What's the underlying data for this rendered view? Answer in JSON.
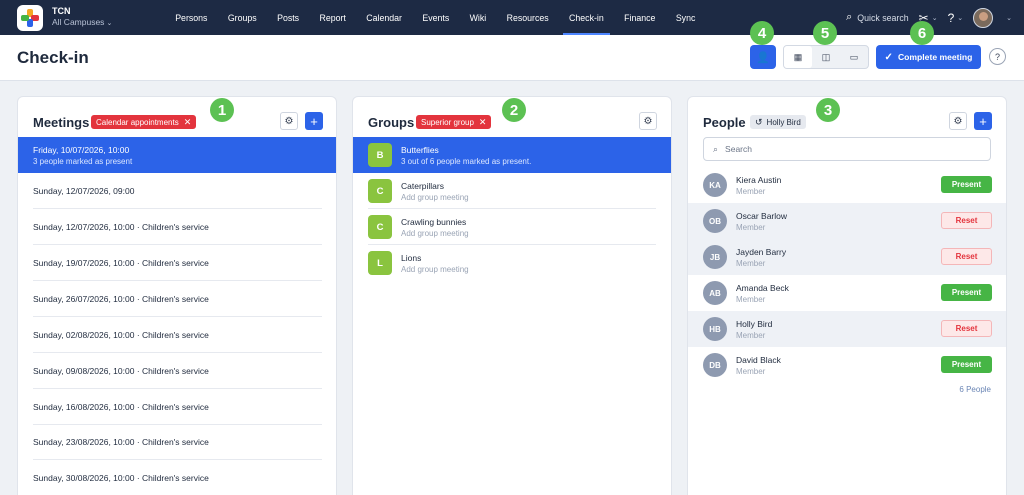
{
  "brand": {
    "name": "TCN",
    "campus": "All Campuses"
  },
  "nav": {
    "items": [
      "Persons",
      "Groups",
      "Posts",
      "Report",
      "Calendar",
      "Events",
      "Wiki",
      "Resources",
      "Check-in",
      "Finance",
      "Sync"
    ],
    "active": "Check-in",
    "quick_search": "Quick search",
    "help": "?"
  },
  "page": {
    "title": "Check-in",
    "complete_label": "Complete meeting",
    "help": "?"
  },
  "callouts": [
    "1",
    "2",
    "3",
    "4",
    "5",
    "6"
  ],
  "meetings": {
    "title": "Meetings",
    "filter_chip": "Calendar appointments",
    "items": [
      {
        "title": "Friday, 10/07/2026, 10:00",
        "sub": "3 people marked as present",
        "selected": true
      },
      {
        "title": "Sunday, 12/07/2026, 09:00"
      },
      {
        "title": "Sunday, 12/07/2026, 10:00 · Children's service"
      },
      {
        "title": "Sunday, 19/07/2026, 10:00 · Children's service"
      },
      {
        "title": "Sunday, 26/07/2026, 10:00 · Children's service"
      },
      {
        "title": "Sunday, 02/08/2026, 10:00 · Children's service"
      },
      {
        "title": "Sunday, 09/08/2026, 10:00 · Children's service"
      },
      {
        "title": "Sunday, 16/08/2026, 10:00 · Children's service"
      },
      {
        "title": "Sunday, 23/08/2026, 10:00 · Children's service"
      },
      {
        "title": "Sunday, 30/08/2026, 10:00 · Children's service"
      }
    ]
  },
  "groups": {
    "title": "Groups",
    "filter_chip": "Superior group",
    "items": [
      {
        "badge": "B",
        "name": "Butterflies",
        "sub": "3 out of 6 people marked as present.",
        "selected": true
      },
      {
        "badge": "C",
        "name": "Caterpillars",
        "sub": "Add group meeting"
      },
      {
        "badge": "C",
        "name": "Crawling bunnies",
        "sub": "Add group meeting"
      },
      {
        "badge": "L",
        "name": "Lions",
        "sub": "Add group meeting"
      }
    ]
  },
  "people": {
    "title": "People",
    "history_chip": "Holly Bird",
    "search_placeholder": "Search",
    "count": "6 People",
    "items": [
      {
        "initials": "KA",
        "name": "Kiera Austin",
        "role": "Member",
        "action": "Present",
        "state": "present"
      },
      {
        "initials": "OB",
        "name": "Oscar Barlow",
        "role": "Member",
        "action": "Reset",
        "state": "reset"
      },
      {
        "initials": "JB",
        "name": "Jayden Barry",
        "role": "Member",
        "action": "Reset",
        "state": "reset"
      },
      {
        "initials": "AB",
        "name": "Amanda Beck",
        "role": "Member",
        "action": "Present",
        "state": "present"
      },
      {
        "initials": "HB",
        "name": "Holly Bird",
        "role": "Member",
        "action": "Reset",
        "state": "reset"
      },
      {
        "initials": "DB",
        "name": "David Black",
        "role": "Member",
        "action": "Present",
        "state": "present"
      }
    ]
  },
  "colors": {
    "nav_bg": "#1d2a44",
    "primary": "#2c63e8",
    "present": "#46b545",
    "reset_text": "#e3343d",
    "callout": "#5cc153",
    "group_badge": "#8ac43f"
  }
}
